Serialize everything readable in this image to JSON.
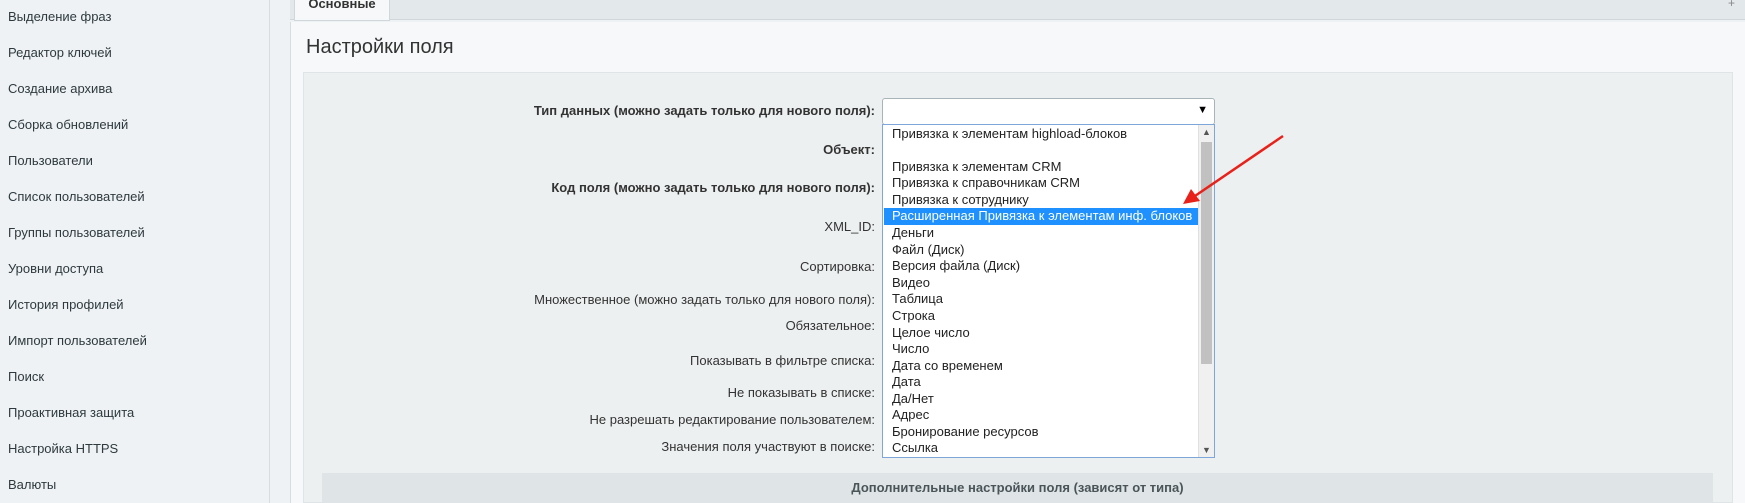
{
  "sidebar": {
    "items": [
      {
        "label": "Выделение фраз"
      },
      {
        "label": "Редактор ключей"
      },
      {
        "label": "Создание архива"
      },
      {
        "label": "Сборка обновлений"
      },
      {
        "label": "Пользователи"
      },
      {
        "label": "Список пользователей"
      },
      {
        "label": "Группы пользователей"
      },
      {
        "label": "Уровни доступа"
      },
      {
        "label": "История профилей"
      },
      {
        "label": "Импорт пользователей"
      },
      {
        "label": "Поиск"
      },
      {
        "label": "Проактивная защита"
      },
      {
        "label": "Настройка HTTPS"
      },
      {
        "label": "Валюты"
      }
    ]
  },
  "tabs": [
    {
      "label": "Основные"
    }
  ],
  "page": {
    "title": "Настройки поля"
  },
  "form": {
    "labels": {
      "data_type": "Тип данных (можно задать только для нового поля):",
      "object": "Объект:",
      "field_code": "Код поля (можно задать только для нового поля):",
      "xml_id": "XML_ID:",
      "sort": "Сортировка:",
      "multiple": "Множественное (можно задать только для нового поля):",
      "required": "Обязательное:",
      "show_filter": "Показывать в фильтре списка:",
      "hide_list": "Не показывать в списке:",
      "no_edit": "Не разрешать редактирование пользователем:",
      "searchable": "Значения поля участвуют в поиске:"
    },
    "data_type_value": ""
  },
  "dropdown": {
    "options": [
      {
        "label": "Привязка к элементам highload-блоков"
      },
      {
        "label": ""
      },
      {
        "label": "Привязка к элементам CRM"
      },
      {
        "label": "Привязка к справочникам CRM"
      },
      {
        "label": "Привязка к сотруднику"
      },
      {
        "label": "Расширенная Привязка к элементам инф. блоков"
      },
      {
        "label": "Деньги"
      },
      {
        "label": "Файл (Диск)"
      },
      {
        "label": "Версия файла (Диск)"
      },
      {
        "label": "Видео"
      },
      {
        "label": "Таблица"
      },
      {
        "label": "Строка"
      },
      {
        "label": "Целое число"
      },
      {
        "label": "Число"
      },
      {
        "label": "Дата со временем"
      },
      {
        "label": "Дата"
      },
      {
        "label": "Да/Нет"
      },
      {
        "label": "Адрес"
      },
      {
        "label": "Бронирование ресурсов"
      },
      {
        "label": "Ссылка"
      }
    ],
    "selected_index": 5
  },
  "extra_settings": {
    "header": "Дополнительные настройки поля (зависят от типа)"
  },
  "colors": {
    "selection": "#1e90ff",
    "annotation_arrow": "#e8221b",
    "dropdown_border": "#7ea6d8"
  }
}
